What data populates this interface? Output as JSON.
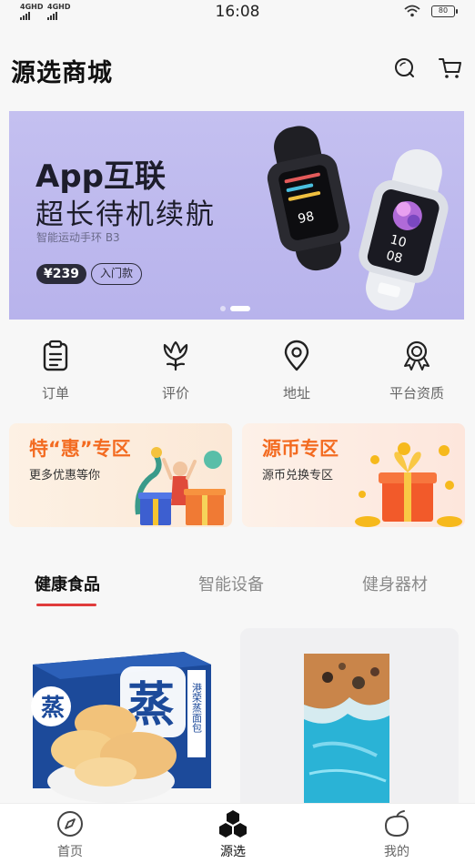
{
  "status_bar": {
    "network_1": "4GHD",
    "network_2": "4GHD",
    "time": "16:08",
    "battery": "80"
  },
  "header": {
    "title": "源选商城",
    "icons": [
      "search-icon",
      "cart-icon"
    ]
  },
  "banner": {
    "title_line1": "App互联",
    "title_line2": "超长待机续航",
    "subtitle": "智能运动手环 B3",
    "price": "¥239",
    "tag": "入门款",
    "watch_time": "10 08",
    "slides": 2,
    "active_slide": 2
  },
  "quick_nav": [
    {
      "label": "订单",
      "icon": "clipboard-icon"
    },
    {
      "label": "评价",
      "icon": "flower-icon"
    },
    {
      "label": "地址",
      "icon": "location-pin-icon"
    },
    {
      "label": "平台资质",
      "icon": "award-ribbon-icon"
    }
  ],
  "promos": [
    {
      "title": "特“惠”专区",
      "subtitle": "更多优惠等你"
    },
    {
      "title": "源币专区",
      "subtitle": "源币兑换专区"
    }
  ],
  "category_tabs": [
    {
      "label": "健康食品",
      "active": true
    },
    {
      "label": "智能设备",
      "active": false
    },
    {
      "label": "健身器材",
      "active": false
    }
  ],
  "products": [
    {
      "package_text": "港荣蒸面包"
    },
    {}
  ],
  "bottom_nav": [
    {
      "label": "首页",
      "icon": "compass-icon",
      "active": false
    },
    {
      "label": "源选",
      "icon": "hexagon-cluster-icon",
      "active": true
    },
    {
      "label": "我的",
      "icon": "peach-icon",
      "active": false
    }
  ],
  "colors": {
    "accent_red": "#e03b3b",
    "promo_orange": "#f36b21",
    "banner_bg": "#c4c0f0"
  }
}
